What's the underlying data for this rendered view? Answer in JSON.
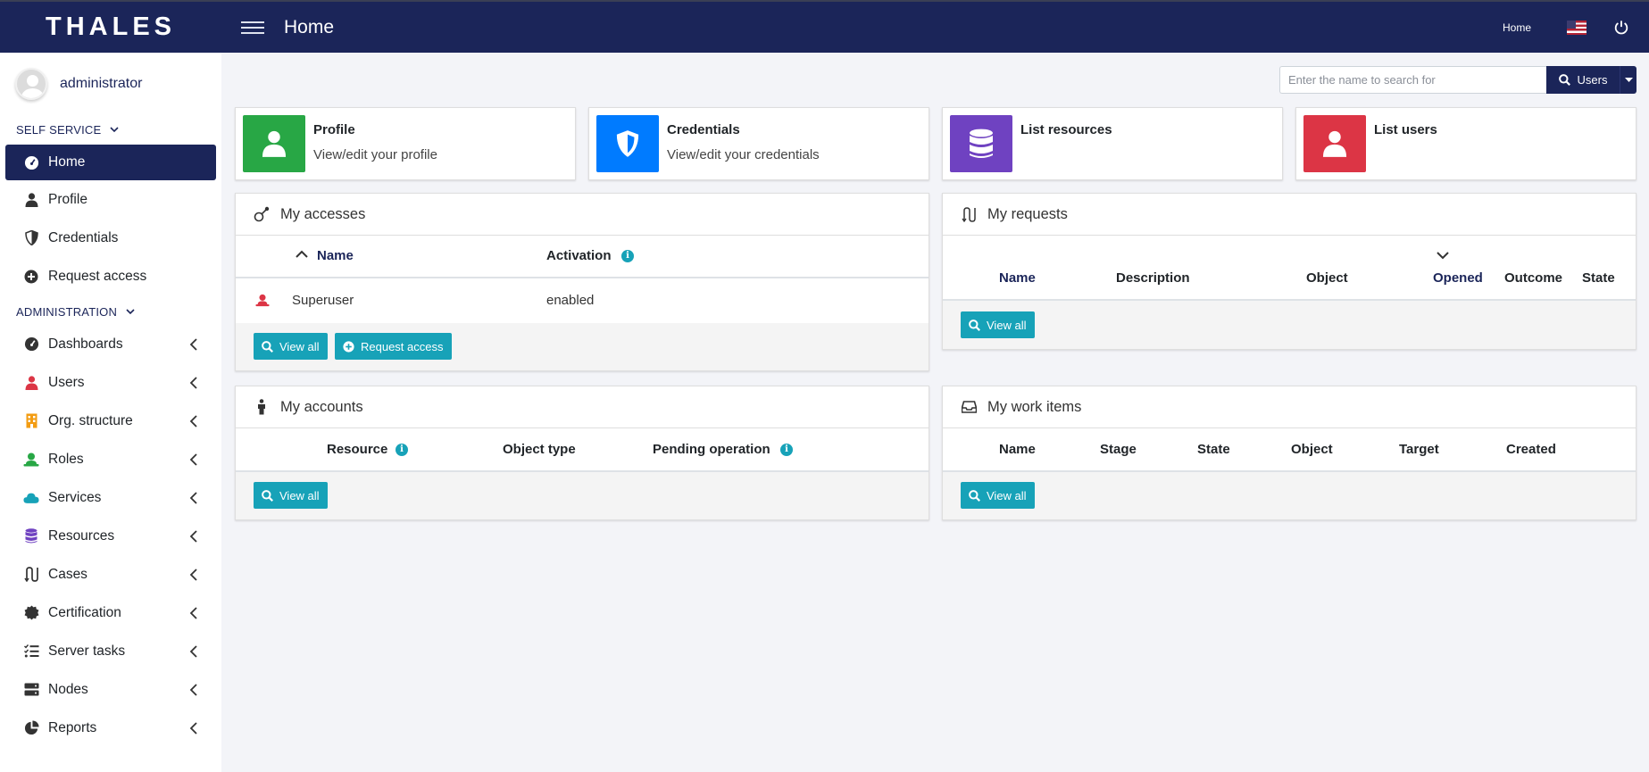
{
  "header": {
    "brand": "THALES",
    "title": "Home",
    "home_link": "Home",
    "flag_icon": "us-flag-icon",
    "logout_icon": "power-icon"
  },
  "sidebar": {
    "username": "administrator",
    "self_service": {
      "label": "SELF SERVICE",
      "items": [
        {
          "label": "Home",
          "icon": "dashboard-icon",
          "active": true
        },
        {
          "label": "Profile",
          "icon": "user-icon"
        },
        {
          "label": "Credentials",
          "icon": "shield-icon"
        },
        {
          "label": "Request access",
          "icon": "plus-circle-icon"
        }
      ]
    },
    "administration": {
      "label": "ADMINISTRATION",
      "items": [
        {
          "label": "Dashboards",
          "icon": "dashboard-icon"
        },
        {
          "label": "Users",
          "icon": "user-icon",
          "color": "#dc3545"
        },
        {
          "label": "Org. structure",
          "icon": "building-icon",
          "color": "#f39c12"
        },
        {
          "label": "Roles",
          "icon": "role-icon",
          "color": "#28a745"
        },
        {
          "label": "Services",
          "icon": "cloud-icon",
          "color": "#17a2b8"
        },
        {
          "label": "Resources",
          "icon": "database-icon",
          "color": "#6f42c1"
        },
        {
          "label": "Cases",
          "icon": "cases-icon"
        },
        {
          "label": "Certification",
          "icon": "certificate-icon"
        },
        {
          "label": "Server tasks",
          "icon": "tasks-icon"
        },
        {
          "label": "Nodes",
          "icon": "server-icon"
        },
        {
          "label": "Reports",
          "icon": "pie-chart-icon"
        }
      ]
    }
  },
  "search": {
    "placeholder": "Enter the name to search for",
    "type_label": "Users"
  },
  "tiles": [
    {
      "title": "Profile",
      "subtitle": "View/edit your profile",
      "color": "#28a745",
      "icon": "user-icon"
    },
    {
      "title": "Credentials",
      "subtitle": "View/edit your credentials",
      "color": "#007bff",
      "icon": "shield-icon"
    },
    {
      "title": "List resources",
      "subtitle": "",
      "color": "#6f42c1",
      "icon": "database-icon"
    },
    {
      "title": "List users",
      "subtitle": "",
      "color": "#dc3545",
      "icon": "user-icon"
    }
  ],
  "my_accesses": {
    "title": "My accesses",
    "columns": [
      "Name",
      "Activation"
    ],
    "rows": [
      {
        "name": "Superuser",
        "activation": "enabled"
      }
    ],
    "view_all": "View all",
    "request_access": "Request access"
  },
  "my_requests": {
    "title": "My requests",
    "columns": [
      "Name",
      "Description",
      "Object",
      "Opened",
      "Outcome",
      "State"
    ],
    "view_all": "View all"
  },
  "my_accounts": {
    "title": "My accounts",
    "columns": [
      "Resource",
      "Object type",
      "Pending operation"
    ],
    "view_all": "View all"
  },
  "my_work_items": {
    "title": "My work items",
    "columns": [
      "Name",
      "Stage",
      "State",
      "Object",
      "Target",
      "Created"
    ],
    "view_all": "View all"
  },
  "colors": {
    "navy": "#1b2559",
    "teal": "#17a2b8"
  }
}
